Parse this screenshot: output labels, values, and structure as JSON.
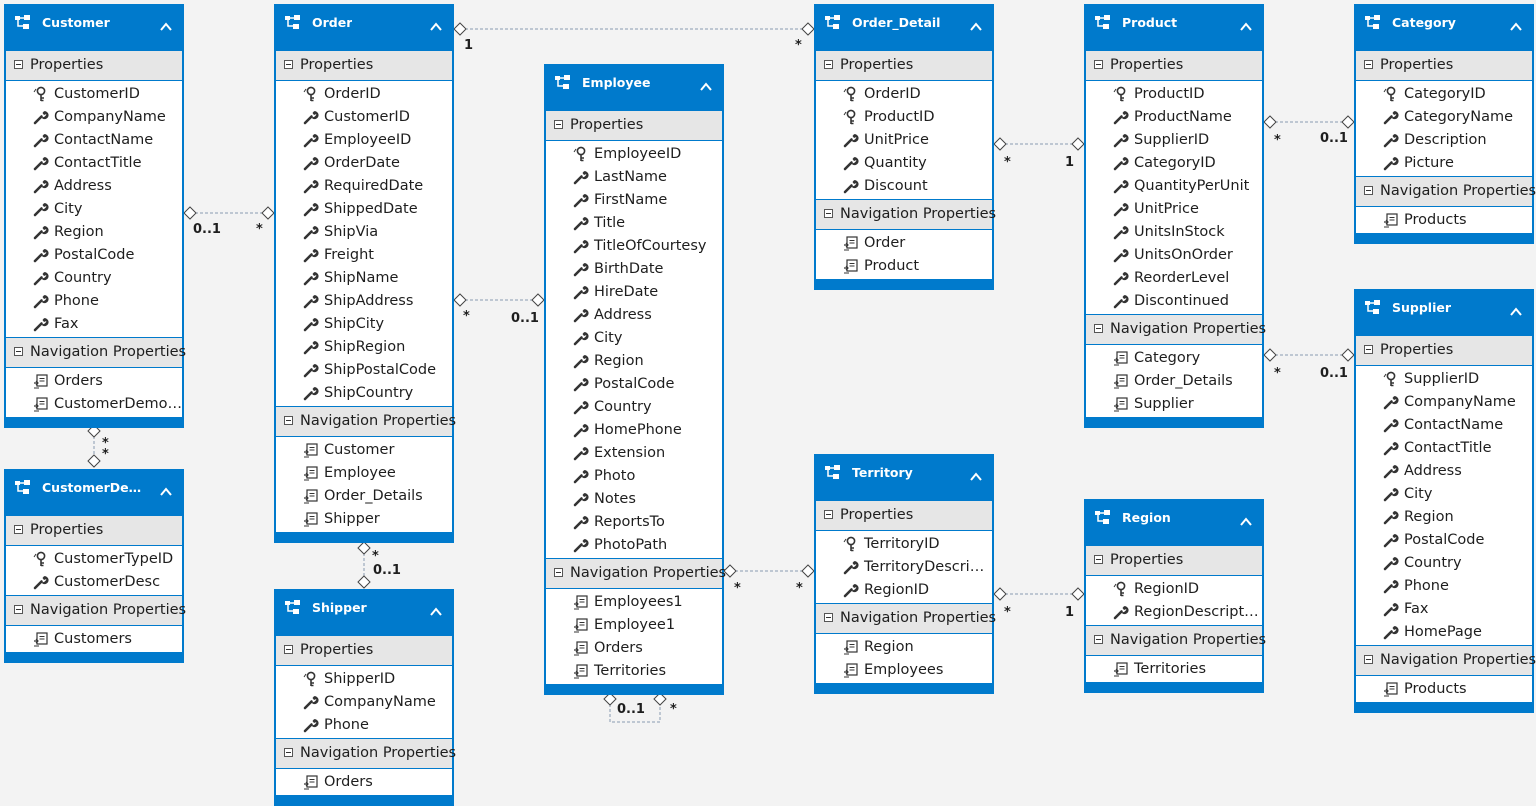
{
  "labels": {
    "properties": "Properties",
    "navigation_properties": "Navigation Properties"
  },
  "colors": {
    "entity_header": "#007acc",
    "section_header": "#e6e6e6",
    "connector": "#8a9bb0"
  },
  "icons": {
    "entity": "entity-type-icon",
    "key": "key-property-icon",
    "property": "wrench-property-icon",
    "navigation": "navigation-property-icon",
    "collapse": "chevron-up-icon"
  },
  "entities": [
    {
      "id": "customer",
      "name": "Customer",
      "properties": [
        {
          "name": "CustomerID",
          "key": true
        },
        {
          "name": "CompanyName"
        },
        {
          "name": "ContactName"
        },
        {
          "name": "ContactTitle"
        },
        {
          "name": "Address"
        },
        {
          "name": "City"
        },
        {
          "name": "Region"
        },
        {
          "name": "PostalCode"
        },
        {
          "name": "Country"
        },
        {
          "name": "Phone"
        },
        {
          "name": "Fax"
        }
      ],
      "navigation": [
        "Orders",
        "CustomerDemo…"
      ]
    },
    {
      "id": "customerdemo",
      "name": "CustomerDem …",
      "properties": [
        {
          "name": "CustomerTypeID",
          "key": true
        },
        {
          "name": "CustomerDesc"
        }
      ],
      "navigation": [
        "Customers"
      ]
    },
    {
      "id": "order",
      "name": "Order",
      "properties": [
        {
          "name": "OrderID",
          "key": true
        },
        {
          "name": "CustomerID"
        },
        {
          "name": "EmployeeID"
        },
        {
          "name": "OrderDate"
        },
        {
          "name": "RequiredDate"
        },
        {
          "name": "ShippedDate"
        },
        {
          "name": "ShipVia"
        },
        {
          "name": "Freight"
        },
        {
          "name": "ShipName"
        },
        {
          "name": "ShipAddress"
        },
        {
          "name": "ShipCity"
        },
        {
          "name": "ShipRegion"
        },
        {
          "name": "ShipPostalCode"
        },
        {
          "name": "ShipCountry"
        }
      ],
      "navigation": [
        "Customer",
        "Employee",
        "Order_Details",
        "Shipper"
      ]
    },
    {
      "id": "shipper",
      "name": "Shipper",
      "properties": [
        {
          "name": "ShipperID",
          "key": true
        },
        {
          "name": "CompanyName"
        },
        {
          "name": "Phone"
        }
      ],
      "navigation": [
        "Orders"
      ]
    },
    {
      "id": "employee",
      "name": "Employee",
      "properties": [
        {
          "name": "EmployeeID",
          "key": true
        },
        {
          "name": "LastName"
        },
        {
          "name": "FirstName"
        },
        {
          "name": "Title"
        },
        {
          "name": "TitleOfCourtesy"
        },
        {
          "name": "BirthDate"
        },
        {
          "name": "HireDate"
        },
        {
          "name": "Address"
        },
        {
          "name": "City"
        },
        {
          "name": "Region"
        },
        {
          "name": "PostalCode"
        },
        {
          "name": "Country"
        },
        {
          "name": "HomePhone"
        },
        {
          "name": "Extension"
        },
        {
          "name": "Photo"
        },
        {
          "name": "Notes"
        },
        {
          "name": "ReportsTo"
        },
        {
          "name": "PhotoPath"
        }
      ],
      "navigation": [
        "Employees1",
        "Employee1",
        "Orders",
        "Territories"
      ]
    },
    {
      "id": "orderdetail",
      "name": "Order_Detail",
      "properties": [
        {
          "name": "OrderID",
          "key": true
        },
        {
          "name": "ProductID",
          "key": true
        },
        {
          "name": "UnitPrice"
        },
        {
          "name": "Quantity"
        },
        {
          "name": "Discount"
        }
      ],
      "navigation": [
        "Order",
        "Product"
      ]
    },
    {
      "id": "territory",
      "name": "Territory",
      "properties": [
        {
          "name": "TerritoryID",
          "key": true
        },
        {
          "name": "TerritoryDescript…"
        },
        {
          "name": "RegionID"
        }
      ],
      "navigation": [
        "Region",
        "Employees"
      ]
    },
    {
      "id": "product",
      "name": "Product",
      "properties": [
        {
          "name": "ProductID",
          "key": true
        },
        {
          "name": "ProductName"
        },
        {
          "name": "SupplierID"
        },
        {
          "name": "CategoryID"
        },
        {
          "name": "QuantityPerUnit"
        },
        {
          "name": "UnitPrice"
        },
        {
          "name": "UnitsInStock"
        },
        {
          "name": "UnitsOnOrder"
        },
        {
          "name": "ReorderLevel"
        },
        {
          "name": "Discontinued"
        }
      ],
      "navigation": [
        "Category",
        "Order_Details",
        "Supplier"
      ]
    },
    {
      "id": "region",
      "name": "Region",
      "properties": [
        {
          "name": "RegionID",
          "key": true
        },
        {
          "name": "RegionDescripti…"
        }
      ],
      "navigation": [
        "Territories"
      ]
    },
    {
      "id": "category",
      "name": "Category",
      "properties": [
        {
          "name": "CategoryID",
          "key": true
        },
        {
          "name": "CategoryName"
        },
        {
          "name": "Description"
        },
        {
          "name": "Picture"
        }
      ],
      "navigation": [
        "Products"
      ]
    },
    {
      "id": "supplier",
      "name": "Supplier",
      "properties": [
        {
          "name": "SupplierID",
          "key": true
        },
        {
          "name": "CompanyName"
        },
        {
          "name": "ContactName"
        },
        {
          "name": "ContactTitle"
        },
        {
          "name": "Address"
        },
        {
          "name": "City"
        },
        {
          "name": "Region"
        },
        {
          "name": "PostalCode"
        },
        {
          "name": "Country"
        },
        {
          "name": "Phone"
        },
        {
          "name": "Fax"
        },
        {
          "name": "HomePage"
        }
      ],
      "navigation": [
        "Products"
      ]
    }
  ],
  "associations": [
    {
      "from": "customer",
      "to": "order",
      "from_mult": "0..1",
      "to_mult": "*"
    },
    {
      "from": "customer",
      "to": "customerdemo",
      "from_mult": "*",
      "to_mult": "*"
    },
    {
      "from": "order",
      "to": "orderdetail",
      "from_mult": "1",
      "to_mult": "*"
    },
    {
      "from": "order",
      "to": "employee",
      "from_mult": "*",
      "to_mult": "0..1"
    },
    {
      "from": "order",
      "to": "shipper",
      "from_mult": "*",
      "to_mult": "0..1"
    },
    {
      "from": "employee",
      "to": "employee",
      "from_mult": "0..1",
      "to_mult": "*"
    },
    {
      "from": "employee",
      "to": "territory",
      "from_mult": "*",
      "to_mult": "*"
    },
    {
      "from": "orderdetail",
      "to": "product",
      "from_mult": "*",
      "to_mult": "1"
    },
    {
      "from": "territory",
      "to": "region",
      "from_mult": "*",
      "to_mult": "1"
    },
    {
      "from": "product",
      "to": "category",
      "from_mult": "*",
      "to_mult": "0..1"
    },
    {
      "from": "product",
      "to": "supplier",
      "from_mult": "*",
      "to_mult": "0..1"
    }
  ]
}
